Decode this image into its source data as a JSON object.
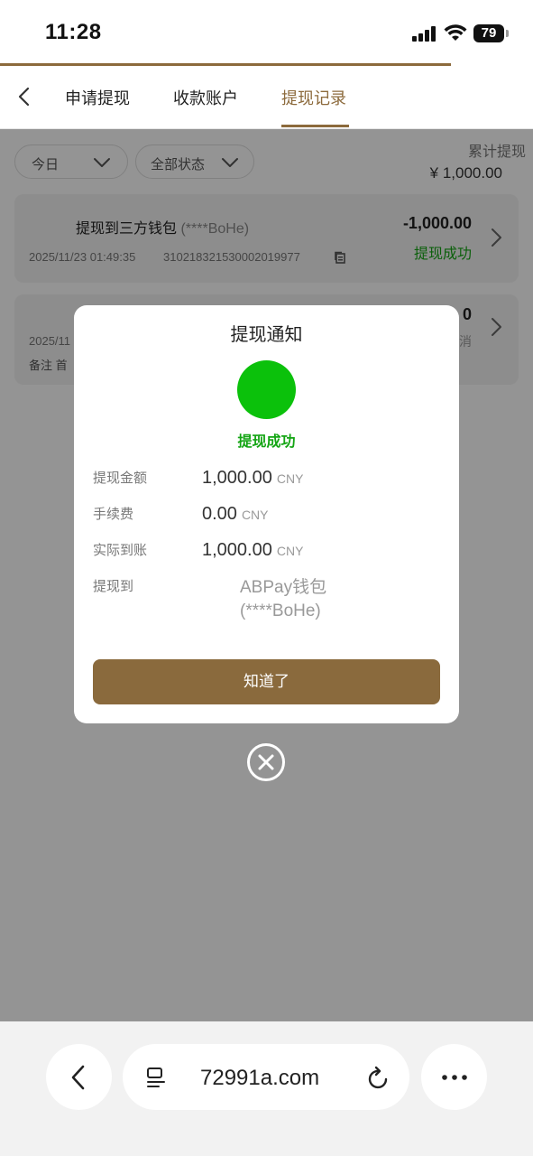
{
  "status_bar": {
    "time": "11:28",
    "battery": "79"
  },
  "nav": {
    "tabs": [
      {
        "label": "申请提现"
      },
      {
        "label": "收款账户"
      },
      {
        "label": "提现记录"
      }
    ]
  },
  "filters": {
    "date": "今日",
    "status": "全部状态"
  },
  "summary": {
    "label": "累计提现",
    "amount": "¥ 1,000.00"
  },
  "records": [
    {
      "title": "提现到三方钱包",
      "masked": "(****BoHe)",
      "datetime": "2025/11/23 01:49:35",
      "order_no": "310218321530002019977",
      "amount": "-1,000.00",
      "status": "提现成功"
    },
    {
      "datetime": "2025/11",
      "note": "备注 首",
      "amount": "0",
      "status": "消"
    }
  ],
  "modal": {
    "title": "提现通知",
    "status": "提现成功",
    "rows": [
      {
        "label": "提现金额",
        "value": "1,000.00",
        "unit": "CNY"
      },
      {
        "label": "手续费",
        "value": "0.00",
        "unit": "CNY"
      },
      {
        "label": "实际到账",
        "value": "1,000.00",
        "unit": "CNY"
      }
    ],
    "dest_label": "提现到",
    "dest_line1": "ABPay钱包",
    "dest_line2": "(****BoHe)",
    "ok_label": "知道了"
  },
  "browser": {
    "url": "72991a.com"
  }
}
